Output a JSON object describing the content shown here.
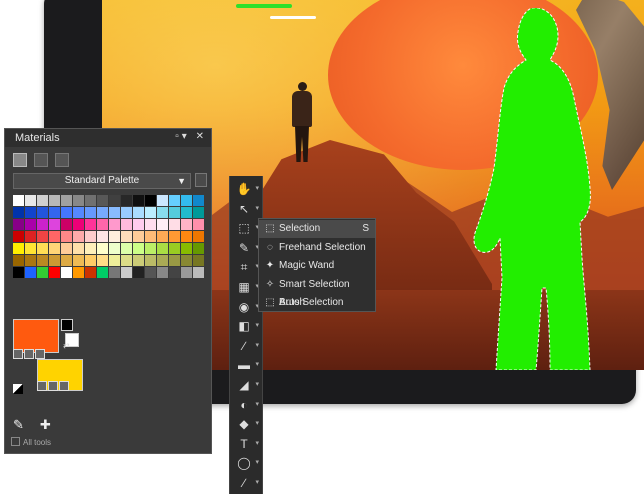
{
  "materials_panel": {
    "title": "Materials",
    "window_buttons": "▫▾ ✕",
    "palette_name": "Standard Palette",
    "all_tools_label": "All tools",
    "foreground_color": "#ff5a0f",
    "background_color": "#ffd300",
    "swatch_colors": [
      "#ffffff",
      "#e8e8e8",
      "#d0d0d0",
      "#b8b8b8",
      "#a0a0a0",
      "#888888",
      "#707070",
      "#585858",
      "#404040",
      "#282828",
      "#101010",
      "#000000",
      "#cce7ff",
      "#66cfff",
      "#33bbee",
      "#1188cc",
      "#0033aa",
      "#1144cc",
      "#2255dd",
      "#3366ee",
      "#4477ff",
      "#5588ff",
      "#6699ff",
      "#77aaff",
      "#88bbff",
      "#99ccff",
      "#aaddff",
      "#bbeeff",
      "#88ddee",
      "#55ccdd",
      "#22bbcc",
      "#009999",
      "#880088",
      "#aa00aa",
      "#cc22cc",
      "#dd44dd",
      "#cc0066",
      "#ee0077",
      "#ff3399",
      "#ff66aa",
      "#ff99cc",
      "#ffbbdd",
      "#ffccee",
      "#ffddee",
      "#ffeef6",
      "#ffdde6",
      "#ffb3c6",
      "#ff8fab",
      "#cc0000",
      "#dd2222",
      "#ee4444",
      "#ff6666",
      "#ff8888",
      "#ffaaaa",
      "#ffcccc",
      "#ffe5e5",
      "#ffeedd",
      "#ffddbb",
      "#ffcc99",
      "#ffbb77",
      "#ffaa55",
      "#ff9933",
      "#ff8811",
      "#ee7700",
      "#ffee00",
      "#ffe533",
      "#ffdd55",
      "#ffd477",
      "#ffcc99",
      "#ffe0aa",
      "#fff0bb",
      "#ffffcc",
      "#eeffcc",
      "#ddffaa",
      "#ccff88",
      "#bbee66",
      "#aadd44",
      "#99cc22",
      "#88bb00",
      "#669900",
      "#996600",
      "#aa7711",
      "#bb8822",
      "#cc9933",
      "#ddaa44",
      "#eebb55",
      "#ffcc66",
      "#ffdd88",
      "#eeee99",
      "#dddd88",
      "#cccc77",
      "#bbbb66",
      "#aaaa55",
      "#999944",
      "#888833",
      "#777722",
      "#000000",
      "#1e63ff",
      "#33cc33",
      "#ff0000",
      "#ffffff",
      "#ff9900",
      "#cc3300",
      "#00cc66",
      "#777777",
      "#cccccc",
      "#222222",
      "#555555",
      "#888888",
      "#444444",
      "#999999",
      "#bbbbbb"
    ]
  },
  "tools": [
    {
      "name": "pan-tool",
      "glyph": "✋"
    },
    {
      "name": "pick-tool",
      "glyph": "↖"
    },
    {
      "name": "selection-tool",
      "glyph": "⬚"
    },
    {
      "name": "dropper-tool",
      "glyph": "✎"
    },
    {
      "name": "crop-tool",
      "glyph": "⌗"
    },
    {
      "name": "straighten-tool",
      "glyph": "▦"
    },
    {
      "name": "red-eye-tool",
      "glyph": "◉"
    },
    {
      "name": "clone-tool",
      "glyph": "◧"
    },
    {
      "name": "paint-brush-tool",
      "glyph": "∕"
    },
    {
      "name": "gradient-tool",
      "glyph": "▬"
    },
    {
      "name": "eraser-tool",
      "glyph": "◢"
    },
    {
      "name": "dodge-tool",
      "glyph": "◐"
    },
    {
      "name": "fill-tool",
      "glyph": "◆"
    },
    {
      "name": "text-tool",
      "glyph": "T"
    },
    {
      "name": "shape-tool",
      "glyph": "◯"
    },
    {
      "name": "brush-tool",
      "glyph": "∕"
    }
  ],
  "flyout_menu": {
    "items": [
      {
        "label": "Selection",
        "shortcut": "S",
        "glyph": "⬚"
      },
      {
        "label": "Freehand Selection",
        "shortcut": "",
        "glyph": "◌"
      },
      {
        "label": "Magic Wand",
        "shortcut": "",
        "glyph": "✦"
      },
      {
        "label": "Smart Selection Brush",
        "shortcut": "",
        "glyph": "✧"
      },
      {
        "label": "Auto Selection",
        "shortcut": "",
        "glyph": "⬚"
      }
    ]
  }
}
